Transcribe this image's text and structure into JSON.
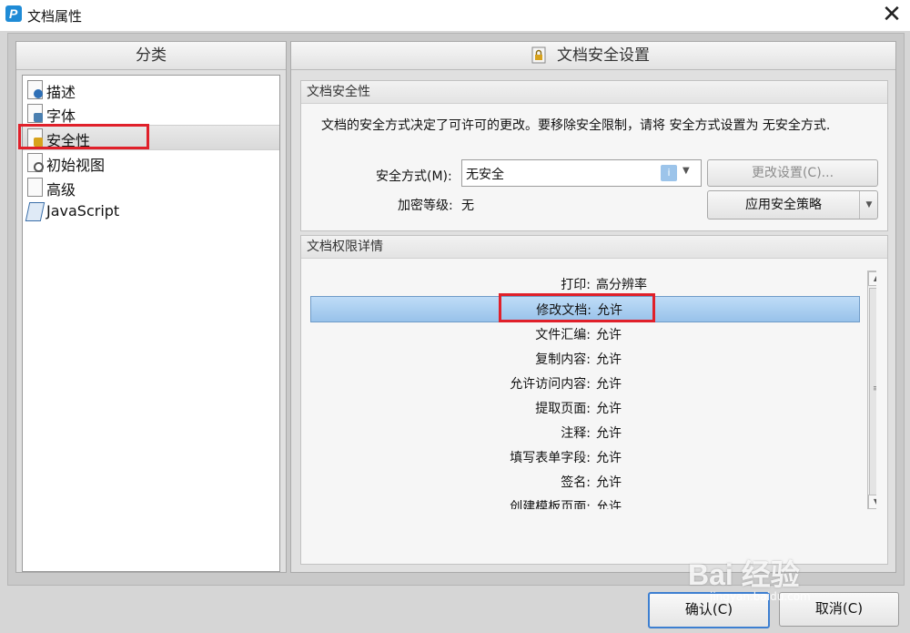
{
  "window": {
    "title": "文档属性",
    "app_icon_letter": "P",
    "close_glyph": "✕"
  },
  "left": {
    "header": "分类",
    "items": [
      {
        "label": "描述",
        "icon": "info-document-icon"
      },
      {
        "label": "字体",
        "icon": "font-document-icon"
      },
      {
        "label": "安全性",
        "icon": "lock-document-icon",
        "selected": true
      },
      {
        "label": "初始视图",
        "icon": "magnifier-document-icon"
      },
      {
        "label": "高级",
        "icon": "document-icon"
      },
      {
        "label": "JavaScript",
        "icon": "script-scroll-icon"
      }
    ]
  },
  "right": {
    "header": "文档安全设置",
    "security": {
      "title": "文档安全性",
      "description": "文档的安全方式决定了可许可的更改。要移除安全限制，请将 安全方式设置为 无安全方式.",
      "method_label": "安全方式(M):",
      "method_value": "无安全",
      "change_button": "更改设置(C)...",
      "encryption_label": "加密等级:",
      "encryption_value": "无",
      "apply_button": "应用安全策略"
    },
    "permissions": {
      "title": "文档权限详情",
      "rows": [
        {
          "key": "打印:",
          "value": "高分辨率"
        },
        {
          "key": "修改文档:",
          "value": "允许",
          "selected": true
        },
        {
          "key": "文件汇编:",
          "value": "允许"
        },
        {
          "key": "复制内容:",
          "value": "允许"
        },
        {
          "key": "允许访问内容:",
          "value": "允许"
        },
        {
          "key": "提取页面:",
          "value": "允许"
        },
        {
          "key": "注释:",
          "value": "允许"
        },
        {
          "key": "填写表单字段:",
          "value": "允许"
        },
        {
          "key": "签名:",
          "value": "允许"
        },
        {
          "key": "创建模板页面:",
          "value": "允许"
        }
      ]
    }
  },
  "footer": {
    "ok": "确认(C)",
    "cancel": "取消(C)"
  },
  "watermark": {
    "brand": "Bai 经验",
    "url": "jingyan.baidu.com"
  },
  "colors": {
    "highlight_box": "#e0202a",
    "selection": "#98c2ea",
    "default_button_border": "#3d7fd1"
  }
}
